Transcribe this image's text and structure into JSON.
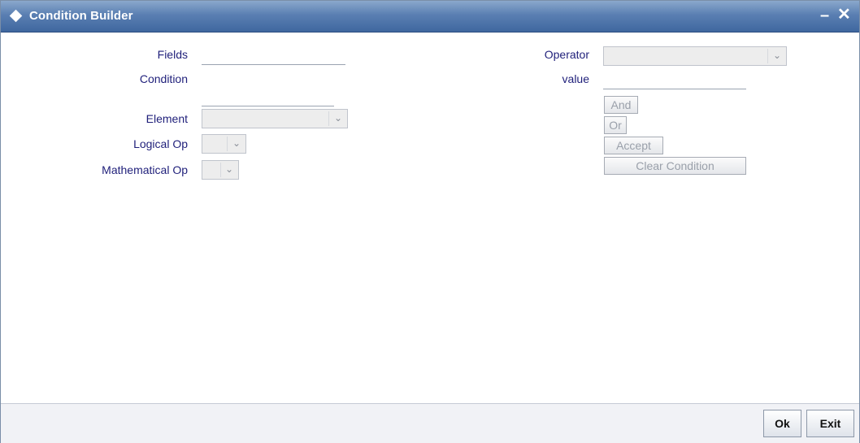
{
  "window": {
    "title": "Condition Builder",
    "minimize_glyph": "–",
    "close_glyph": "✕"
  },
  "form": {
    "fields_label": "Fields",
    "fields_value": "",
    "condition_label": "Condition",
    "condition_value": "",
    "element_label": "Element",
    "element_value": "",
    "logical_op_label": "Logical Op",
    "logical_op_value": "",
    "mathematical_op_label": "Mathematical Op",
    "mathematical_op_value": "",
    "operator_label": "Operator",
    "operator_value": "",
    "value_label": "value",
    "value_value": ""
  },
  "actions": {
    "and_label": "And",
    "or_label": "Or",
    "accept_label": "Accept",
    "clear_condition_label": "Clear Condition"
  },
  "footer": {
    "ok_label": "Ok",
    "exit_label": "Exit"
  },
  "icons": {
    "title_icon": "diamond-icon",
    "dropdown_icon": "chevron-down-icon"
  },
  "colors": {
    "titlebar": "#4a6fa5",
    "label_text": "#1f1f7a",
    "disabled_text": "#9aa0aa"
  }
}
